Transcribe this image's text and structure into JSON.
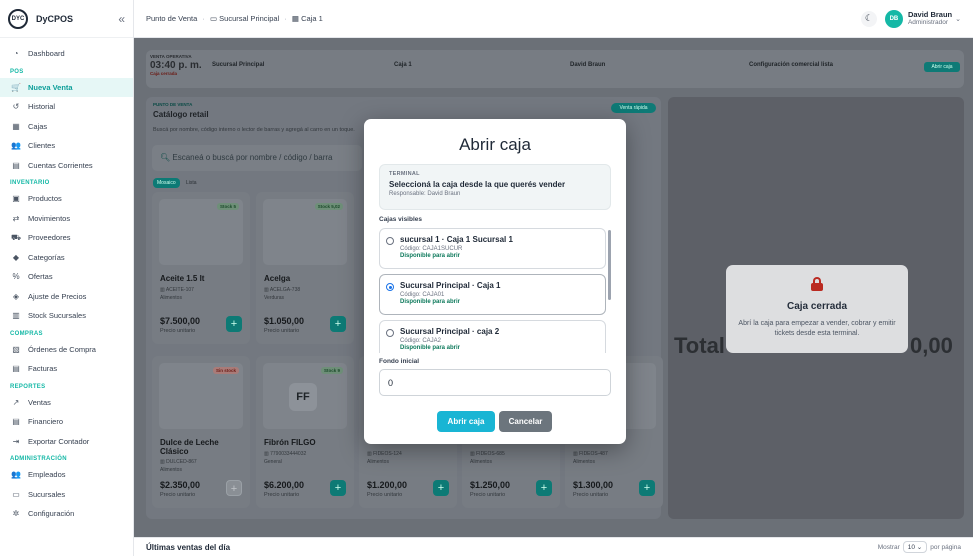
{
  "app": {
    "brand": "DyCPOS",
    "logo_text": "DYC"
  },
  "sidebar": {
    "items": [
      {
        "label": "Dashboard",
        "icon": "dashboard-icon",
        "glyph": "◔"
      },
      {
        "section": "POS"
      },
      {
        "label": "Nueva Venta",
        "icon": "cart-icon",
        "glyph": "🛒",
        "active": true
      },
      {
        "label": "Historial",
        "icon": "history-icon",
        "glyph": "↺"
      },
      {
        "label": "Cajas",
        "icon": "cash-register-icon",
        "glyph": "▦"
      },
      {
        "label": "Clientes",
        "icon": "users-icon",
        "glyph": "👥"
      },
      {
        "label": "Cuentas Corrientes",
        "icon": "ledger-icon",
        "glyph": "▤"
      },
      {
        "section": "INVENTARIO"
      },
      {
        "label": "Productos",
        "icon": "boxes-icon",
        "glyph": "▣"
      },
      {
        "label": "Movimientos",
        "icon": "swap-icon",
        "glyph": "⇄"
      },
      {
        "label": "Proveedores",
        "icon": "truck-icon",
        "glyph": "⛟"
      },
      {
        "label": "Categorías",
        "icon": "tag-icon",
        "glyph": "◆"
      },
      {
        "label": "Ofertas",
        "icon": "percent-icon",
        "glyph": "%"
      },
      {
        "label": "Ajuste de Precios",
        "icon": "price-tag-icon",
        "glyph": "◈"
      },
      {
        "label": "Stock Sucursales",
        "icon": "warehouse-icon",
        "glyph": "▥"
      },
      {
        "section": "COMPRAS"
      },
      {
        "label": "Órdenes de Compra",
        "icon": "orders-icon",
        "glyph": "▧"
      },
      {
        "label": "Facturas",
        "icon": "invoice-icon",
        "glyph": "▤"
      },
      {
        "section": "REPORTES"
      },
      {
        "label": "Ventas",
        "icon": "chart-icon",
        "glyph": "↗"
      },
      {
        "label": "Financiero",
        "icon": "finance-icon",
        "glyph": "▤"
      },
      {
        "label": "Exportar Contador",
        "icon": "export-icon",
        "glyph": "⇥"
      },
      {
        "section": "ADMINISTRACIÓN"
      },
      {
        "label": "Empleados",
        "icon": "employees-icon",
        "glyph": "👥"
      },
      {
        "label": "Sucursales",
        "icon": "store-icon",
        "glyph": "▭"
      },
      {
        "label": "Configuración",
        "icon": "gear-icon",
        "glyph": "✲"
      }
    ]
  },
  "header": {
    "crumbs": [
      "Punto de Venta",
      "Sucursal Principal",
      "Caja 1"
    ],
    "user_name": "David Braun",
    "user_role": "Administrador",
    "avatar": "DB"
  },
  "shift": {
    "label": "VENTA OPERATIVA",
    "time": "03:40 p. m.",
    "status": "Caja cerrada",
    "branch": "Sucursal Principal",
    "register": "Caja 1",
    "cashier": "David Braun",
    "commercial": "Configuración comercial lista",
    "action": "Abrir caja"
  },
  "catalog": {
    "label": "PUNTO DE VENTA",
    "title": "Catálogo retail",
    "subtitle": "Buscá por nombre, código interno o lector de barras y agregá al carro en un toque.",
    "search_placeholder": "Escaneá o buscá por nombre / código / barra",
    "view_mosaic": "Mosaico",
    "view_list": "Lista",
    "quick_sale": "Venta rápida",
    "products": [
      {
        "name": "Aceite 1.5 lt",
        "code": "ACEITE-107",
        "category": "Alimentos",
        "price": "$7.500,00",
        "unit": "Precio unitario",
        "stock": "Stock 5"
      },
      {
        "name": "Acelga",
        "code": "ACELGA-738",
        "category": "Verduras",
        "price": "$1.050,00",
        "unit": "Precio unitario",
        "stock": "Stock 5,02"
      },
      {
        "name": "Dulce de Leche Clásico",
        "code": "DULCED-867",
        "category": "Alimentos",
        "price": "$2.350,00",
        "unit": "Precio unitario",
        "stock": "Sin stock"
      },
      {
        "name": "Fibrón FILGO",
        "code": "7790033444032",
        "category": "General",
        "price": "$6.200,00",
        "unit": "Precio unitario",
        "stock": "Stock 9",
        "initials": "FF"
      },
      {
        "code": "FIDEOS-124",
        "category": "Alimentos",
        "price": "$1.200,00",
        "unit": "Precio unitario"
      },
      {
        "code": "FIDEOS-685",
        "category": "Alimentos",
        "price": "$1.250,00",
        "unit": "Precio unitario"
      },
      {
        "code": "FIDEOS-487",
        "category": "Alimentos",
        "price": "$1.300,00",
        "unit": "Precio unitario"
      }
    ]
  },
  "cart": {
    "closed_title": "Caja cerrada",
    "closed_desc": "Abrí la caja para empezar a vender, cobrar y emitir tickets desde esta terminal.",
    "total_label": "Total",
    "total_value": "0,00"
  },
  "modal": {
    "title": "Abrir caja",
    "terminal_label": "TERMINAL",
    "terminal_text": "Seleccioná la caja desde la que querés vender",
    "responsible": "Responsable: David Braun",
    "visible_label": "Cajas visibles",
    "options": [
      {
        "name": "sucursal 1 · Caja 1 Sucursal 1",
        "code": "Código: CAJA1SUCUR",
        "avail": "Disponible para abrir",
        "selected": false
      },
      {
        "name": "Sucursal Principal · Caja 1",
        "code": "Código: CAJA01",
        "avail": "Disponible para abrir",
        "selected": true
      },
      {
        "name": "Sucursal Principal · caja 2",
        "code": "Código: CAJA2",
        "avail": "Disponible para abrir",
        "selected": false
      }
    ],
    "fund_label": "Fondo inicial",
    "fund_value": "0",
    "open_btn": "Abrir caja",
    "cancel_btn": "Cancelar"
  },
  "footer": {
    "last_sales": "Últimas ventas del día",
    "show": "Mostrar",
    "per_page_value": "10",
    "per_page": "por página"
  },
  "colors": {
    "accent": "#14b8a6",
    "primary_btn": "#19b5d4",
    "danger": "#c2261c"
  }
}
